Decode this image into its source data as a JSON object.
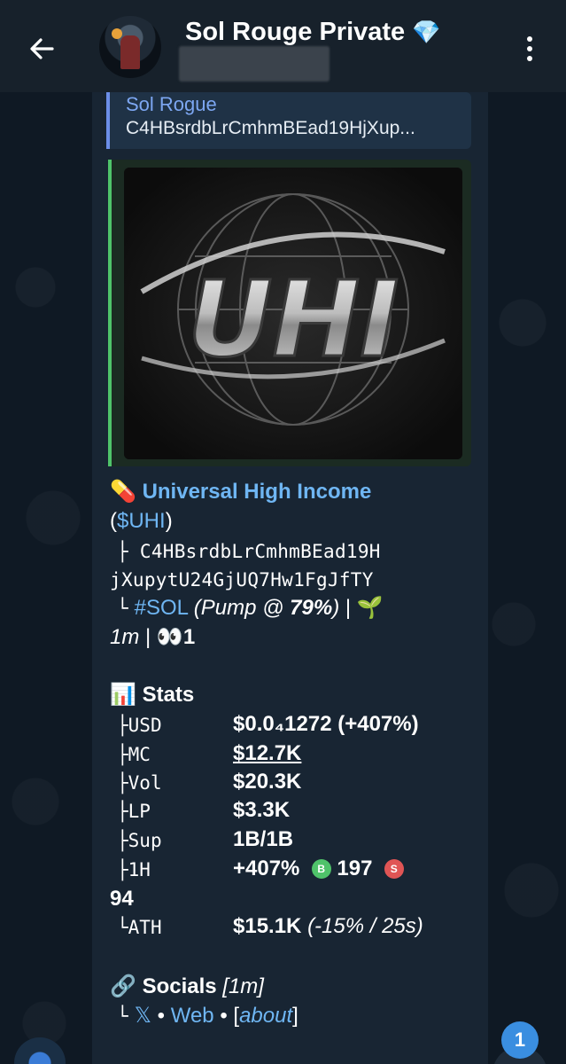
{
  "header": {
    "title": "Sol Rouge Private",
    "title_emoji": "💎"
  },
  "reply": {
    "name": "Sol Rogue",
    "text": "C4HBsrdbLrCmhmBEad19HjXup..."
  },
  "media": {
    "logo_text": "UHI"
  },
  "message": {
    "pill_emoji": "💊",
    "token_name": "Universal High Income",
    "ticker_open": "(",
    "ticker": "$UHI",
    "ticker_close": ")",
    "tree_branch": "├",
    "tree_end": "└",
    "address_line1": "C4HBsrdbLrCmhmBEad19H",
    "address_line2": "jXupytU24GjUQ7Hw1FgJfTY",
    "chain_tag": "#SOL",
    "pump_text_prefix": "(Pump @ ",
    "pump_pct": "79%",
    "pump_text_suffix": ")",
    "separator": "|",
    "sprout_emoji": "🌱",
    "age": "1m",
    "eyes_emoji": "👀",
    "watchers": "1"
  },
  "stats": {
    "icon": "📊",
    "heading": "Stats",
    "rows": [
      {
        "prefix": "├",
        "label": "USD",
        "value": "$0.0₄1272 (+407%)"
      },
      {
        "prefix": "├",
        "label": "MC",
        "value": "$12.7K"
      },
      {
        "prefix": "├",
        "label": "Vol",
        "value": "$20.3K"
      },
      {
        "prefix": "├",
        "label": "LP",
        "value": "$3.3K"
      },
      {
        "prefix": "├",
        "label": "Sup",
        "value": "1B/1B"
      }
    ],
    "hour_row": {
      "prefix": "├",
      "label": "1H",
      "change": "+407%",
      "buy_badge": "B",
      "buys": "197",
      "sell_badge": "S",
      "sells": "94"
    },
    "ath_row": {
      "prefix": "└",
      "label": "ATH",
      "value": "$15.1K",
      "detail": "(-15% / 25s)"
    }
  },
  "socials": {
    "icon": "🔗",
    "heading": "Socials",
    "age": "[1m]",
    "prefix": "└",
    "x_label": "𝕏",
    "dot": "•",
    "web_label": "Web",
    "about_open": "[",
    "about_label": "about",
    "about_close": "]"
  },
  "unread_count": "1",
  "colors": {
    "header_bg": "#17212b",
    "bubble_bg": "#182533",
    "link": "#6fb6f3",
    "reply_accent": "#6c8ee8",
    "media_accent": "#4fc36a",
    "buy_badge": "#4fc36a",
    "sell_badge": "#e05555",
    "unread_badge": "#3a8ee0"
  }
}
